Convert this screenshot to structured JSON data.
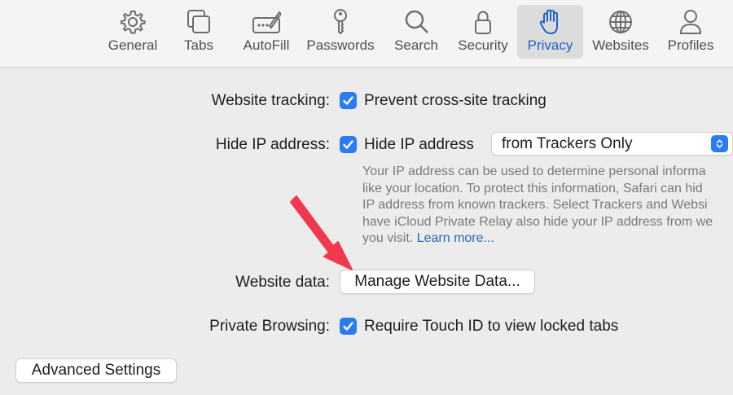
{
  "toolbar": {
    "tabs": [
      {
        "label": "General",
        "icon": "gear-icon"
      },
      {
        "label": "Tabs",
        "icon": "tabs-icon"
      },
      {
        "label": "AutoFill",
        "icon": "autofill-icon"
      },
      {
        "label": "Passwords",
        "icon": "key-icon"
      },
      {
        "label": "Search",
        "icon": "magnifier-icon"
      },
      {
        "label": "Security",
        "icon": "lock-icon"
      },
      {
        "label": "Privacy",
        "icon": "hand-icon"
      },
      {
        "label": "Websites",
        "icon": "globe-icon"
      },
      {
        "label": "Profiles",
        "icon": "person-icon"
      }
    ],
    "selected": "Privacy"
  },
  "privacy": {
    "website_tracking": {
      "label": "Website tracking:",
      "checkbox_label": "Prevent cross-site tracking",
      "checked": true
    },
    "hide_ip": {
      "label": "Hide IP address:",
      "checkbox_label": "Hide IP address",
      "checked": true,
      "popup_value": "from Trackers Only",
      "description_lines": [
        "Your IP address can be used to determine personal informa",
        "like your location. To protect this information, Safari can hid",
        "IP address from known trackers. Select Trackers and Websi",
        "have iCloud Private Relay also hide your IP address from we"
      ],
      "description_last": "you visit.",
      "learn_more": "Learn more..."
    },
    "website_data": {
      "label": "Website data:",
      "button": "Manage Website Data..."
    },
    "private_browsing": {
      "label": "Private Browsing:",
      "checkbox_label": "Require Touch ID to view locked tabs",
      "checked": true
    }
  },
  "footer": {
    "advanced_button": "Advanced Settings"
  },
  "colors": {
    "accent": "#2b7bf3",
    "selected_tab_text": "#1f62c8",
    "annotation_arrow": "#f0394d"
  }
}
